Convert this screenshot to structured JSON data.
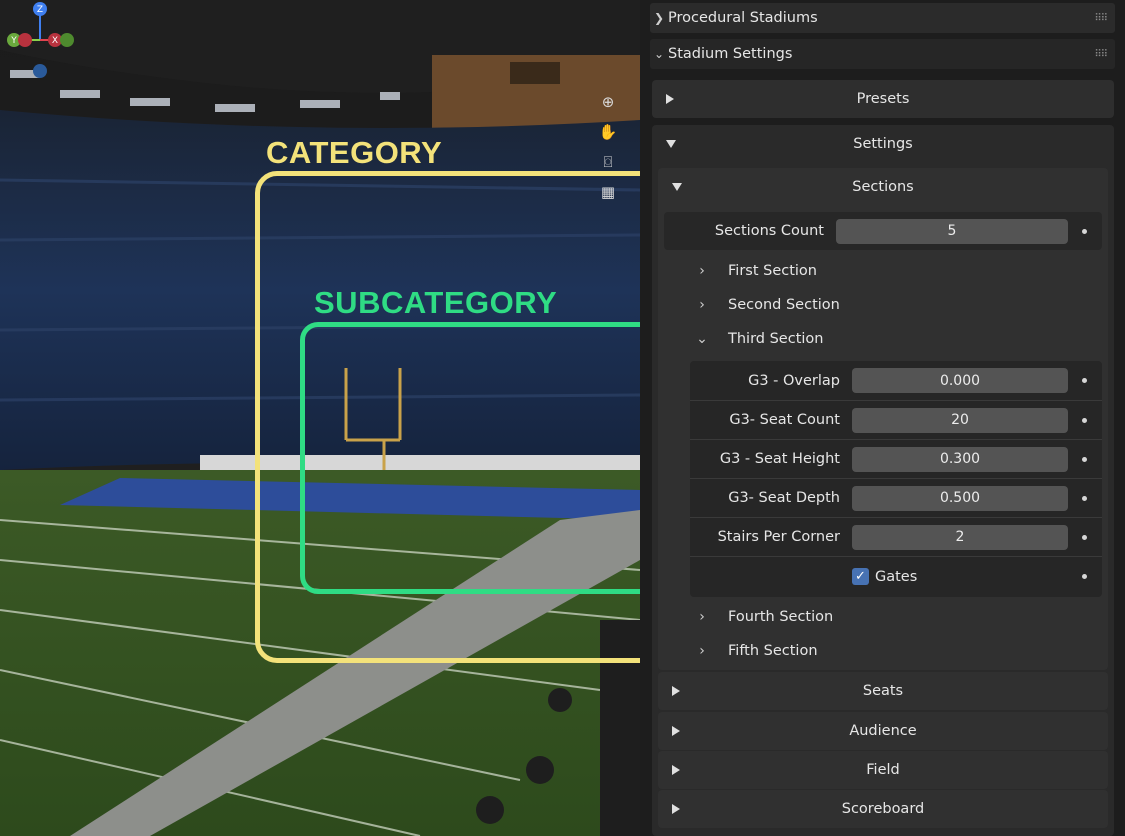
{
  "overlay": {
    "category_label": "CATEGORY",
    "subcategory_label": "SUBCATEGORY"
  },
  "gizmo": {
    "z": "Z",
    "y": "Y",
    "x": "X"
  },
  "panel": {
    "addon_title": "Procedural Stadiums",
    "stadium_settings_title": "Stadium Settings",
    "presets_label": "Presets",
    "settings_label": "Settings",
    "sections_label": "Sections",
    "sections_count": {
      "label": "Sections Count",
      "value": "5"
    },
    "first_section": "First Section",
    "second_section": "Second Section",
    "third_section": "Third Section",
    "third_section_props": [
      {
        "label": "G3 - Overlap",
        "value": "0.000"
      },
      {
        "label": "G3- Seat Count",
        "value": "20"
      },
      {
        "label": "G3 - Seat Height",
        "value": "0.300"
      },
      {
        "label": "G3- Seat Depth",
        "value": "0.500"
      },
      {
        "label": "Stairs Per Corner",
        "value": "2"
      }
    ],
    "gates_label": "Gates",
    "gates_checked": true,
    "fourth_section": "Fourth Section",
    "fifth_section": "Fifth Section",
    "collapsed_panels": [
      "Seats",
      "Audience",
      "Field",
      "Scoreboard"
    ]
  },
  "colors": {
    "category": "#f3e27a",
    "subcategory": "#2fdc84",
    "checkbox": "#4772b3",
    "field_bg": "#545454"
  }
}
